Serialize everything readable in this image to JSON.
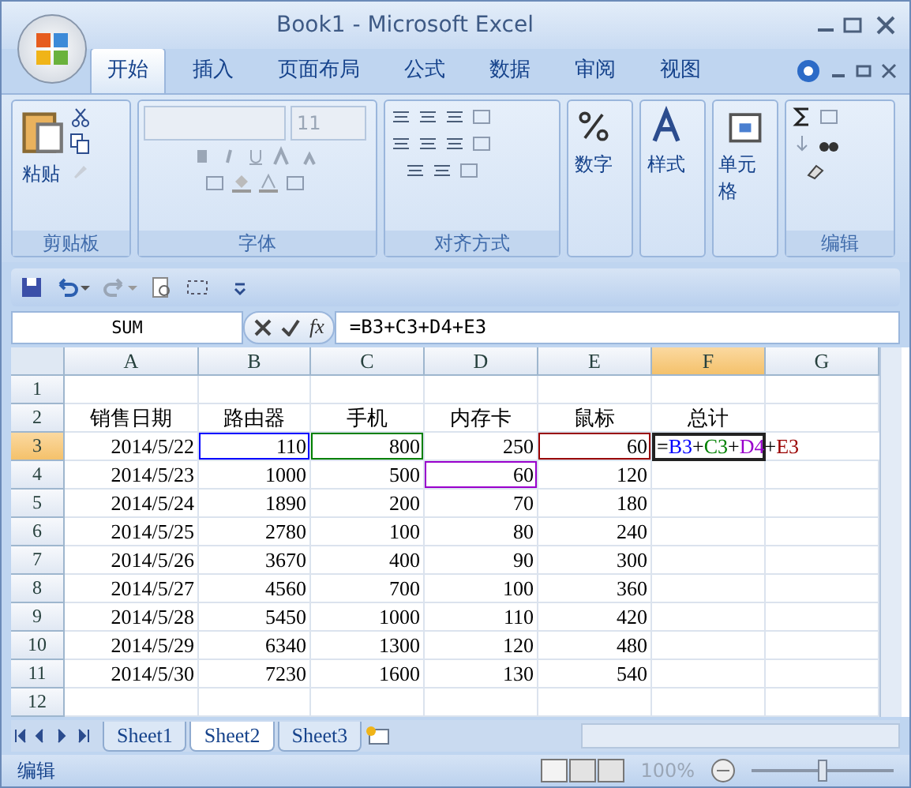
{
  "window": {
    "title": "Book1 - Microsoft Excel"
  },
  "tabs": [
    {
      "label": "开始",
      "selected": true
    },
    {
      "label": "插入",
      "selected": false
    },
    {
      "label": "页面布局",
      "selected": false
    },
    {
      "label": "公式",
      "selected": false
    },
    {
      "label": "数据",
      "selected": false
    },
    {
      "label": "审阅",
      "selected": false
    },
    {
      "label": "视图",
      "selected": false
    }
  ],
  "ribbon": {
    "groups": [
      {
        "kind": "clipboard",
        "label": "剪贴板",
        "button": "粘贴"
      },
      {
        "kind": "font",
        "label": "字体",
        "font_size": "11"
      },
      {
        "kind": "alignment",
        "label": "对齐方式"
      },
      {
        "kind": "number",
        "button": "数字"
      },
      {
        "kind": "styles",
        "button": "样式"
      },
      {
        "kind": "cells",
        "button": "单元格"
      },
      {
        "kind": "editing",
        "label": "编辑"
      }
    ]
  },
  "formula_bar": {
    "name_box": "SUM",
    "function_button": "fx",
    "formula": "=B3+C3+D4+E3"
  },
  "grid": {
    "columns": [
      {
        "label": "A",
        "selected": false
      },
      {
        "label": "B",
        "selected": false
      },
      {
        "label": "C",
        "selected": false
      },
      {
        "label": "D",
        "selected": false
      },
      {
        "label": "E",
        "selected": false
      },
      {
        "label": "F",
        "selected": true
      },
      {
        "label": "G",
        "selected": false
      }
    ],
    "rows": [
      {
        "header": "1",
        "selected": false,
        "cells": []
      },
      {
        "header": "2",
        "selected": false,
        "kind": "header",
        "cells": [
          {
            "text": "销售日期"
          },
          {
            "text": "路由器"
          },
          {
            "text": "手机"
          },
          {
            "text": "内存卡"
          },
          {
            "text": "鼠标"
          },
          {
            "text": "总计"
          }
        ]
      },
      {
        "header": "3",
        "selected": true,
        "kind": "data",
        "cells": [
          {
            "text": "2014/5/22"
          },
          {
            "text": "110",
            "color": "#0000ff"
          },
          {
            "text": "800",
            "color": "#008000"
          },
          {
            "text": "250"
          },
          {
            "text": "60",
            "color": "#990000"
          },
          {
            "kind": "formula",
            "parts": [
              {
                "text": "=",
                "color": "#000000"
              },
              {
                "text": "B3",
                "color": "#0000ff"
              },
              {
                "text": "+",
                "color": "#000000"
              },
              {
                "text": "C3",
                "color": "#008000"
              },
              {
                "text": "+",
                "color": "#000000"
              },
              {
                "text": "D4",
                "color": "#9900cc"
              },
              {
                "text": "+",
                "color": "#000000"
              },
              {
                "text": "E3",
                "color": "#990000"
              }
            ]
          }
        ]
      },
      {
        "header": "4",
        "selected": false,
        "kind": "data",
        "cells": [
          {
            "text": "2014/5/23"
          },
          {
            "text": "1000"
          },
          {
            "text": "500"
          },
          {
            "text": "60",
            "color": "#9900cc"
          },
          {
            "text": "120"
          }
        ]
      },
      {
        "header": "5",
        "selected": false,
        "kind": "data",
        "cells": [
          {
            "text": "2014/5/24"
          },
          {
            "text": "1890"
          },
          {
            "text": "200"
          },
          {
            "text": "70"
          },
          {
            "text": "180"
          }
        ]
      },
      {
        "header": "6",
        "selected": false,
        "kind": "data",
        "cells": [
          {
            "text": "2014/5/25"
          },
          {
            "text": "2780"
          },
          {
            "text": "100"
          },
          {
            "text": "80"
          },
          {
            "text": "240"
          }
        ]
      },
      {
        "header": "7",
        "selected": false,
        "kind": "data",
        "cells": [
          {
            "text": "2014/5/26"
          },
          {
            "text": "3670"
          },
          {
            "text": "400"
          },
          {
            "text": "90"
          },
          {
            "text": "300"
          }
        ]
      },
      {
        "header": "8",
        "selected": false,
        "kind": "data",
        "cells": [
          {
            "text": "2014/5/27"
          },
          {
            "text": "4560"
          },
          {
            "text": "700"
          },
          {
            "text": "100"
          },
          {
            "text": "360"
          }
        ]
      },
      {
        "header": "9",
        "selected": false,
        "kind": "data",
        "cells": [
          {
            "text": "2014/5/28"
          },
          {
            "text": "5450"
          },
          {
            "text": "1000"
          },
          {
            "text": "110"
          },
          {
            "text": "420"
          }
        ]
      },
      {
        "header": "10",
        "selected": false,
        "kind": "data",
        "cells": [
          {
            "text": "2014/5/29"
          },
          {
            "text": "6340"
          },
          {
            "text": "1300"
          },
          {
            "text": "120"
          },
          {
            "text": "480"
          }
        ]
      },
      {
        "header": "11",
        "selected": false,
        "kind": "data",
        "cells": [
          {
            "text": "2014/5/30"
          },
          {
            "text": "7230"
          },
          {
            "text": "1600"
          },
          {
            "text": "130"
          },
          {
            "text": "540"
          }
        ]
      },
      {
        "header": "12",
        "selected": false,
        "cells": []
      }
    ]
  },
  "sheets": [
    {
      "label": "Sheet1",
      "selected": false
    },
    {
      "label": "Sheet2",
      "selected": true
    },
    {
      "label": "Sheet3",
      "selected": false
    }
  ],
  "status_bar": {
    "mode": "编辑",
    "zoom": "100%",
    "level": 0.5
  }
}
